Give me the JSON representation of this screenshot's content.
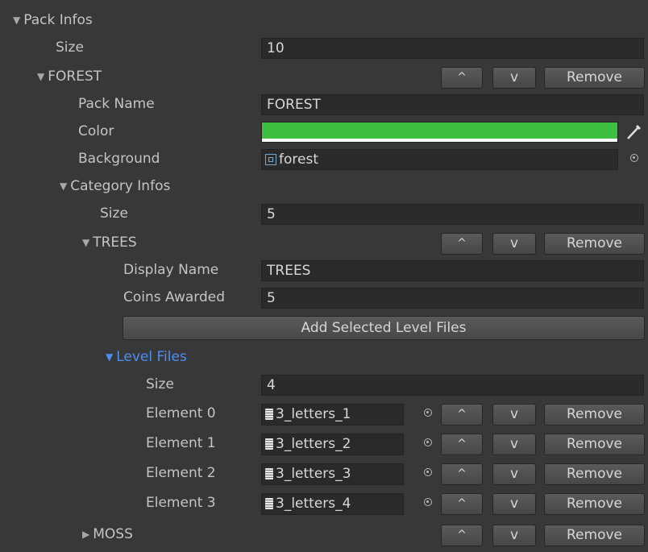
{
  "root": {
    "label": "Pack Infos"
  },
  "size": {
    "label": "Size",
    "value": "10"
  },
  "forest": {
    "label": "FOREST",
    "up_label": "^",
    "down_label": "v",
    "remove_label": "Remove",
    "pack_name": {
      "label": "Pack Name",
      "value": "FOREST"
    },
    "color": {
      "label": "Color",
      "value": "#3fbf3f"
    },
    "background": {
      "label": "Background",
      "value": "forest"
    },
    "category_infos": {
      "label": "Category Infos",
      "size": {
        "label": "Size",
        "value": "5"
      },
      "trees": {
        "label": "TREES",
        "up_label": "^",
        "down_label": "v",
        "remove_label": "Remove",
        "display_name": {
          "label": "Display Name",
          "value": "TREES"
        },
        "coins_awarded": {
          "label": "Coins Awarded",
          "value": "5"
        },
        "add_button": "Add Selected Level Files",
        "level_files": {
          "label": "Level Files",
          "size": {
            "label": "Size",
            "value": "4"
          },
          "elements": [
            {
              "label": "Element 0",
              "value": "3_letters_1"
            },
            {
              "label": "Element 1",
              "value": "3_letters_2"
            },
            {
              "label": "Element 2",
              "value": "3_letters_3"
            },
            {
              "label": "Element 3",
              "value": "3_letters_4"
            }
          ]
        }
      },
      "moss": {
        "label": "MOSS",
        "up_label": "^",
        "down_label": "v",
        "remove_label": "Remove"
      }
    }
  },
  "colors": {
    "accent": "#4d8ef5",
    "background": "#383838"
  }
}
